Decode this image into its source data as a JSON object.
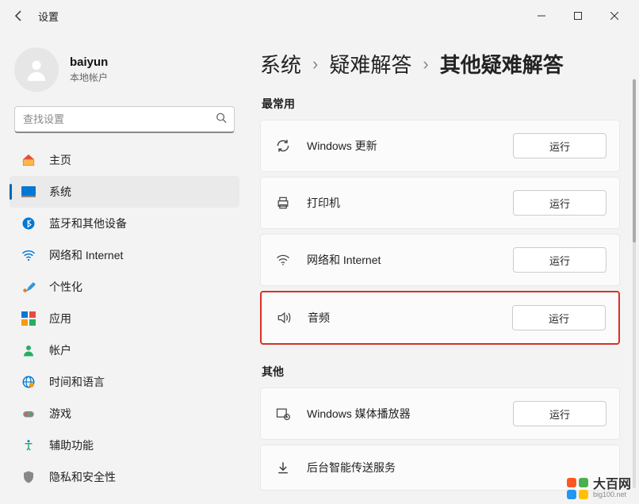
{
  "window": {
    "title": "设置"
  },
  "profile": {
    "name": "baiyun",
    "sub": "本地帐户"
  },
  "search": {
    "placeholder": "查找设置"
  },
  "nav": {
    "items": [
      {
        "label": "主页"
      },
      {
        "label": "系统"
      },
      {
        "label": "蓝牙和其他设备"
      },
      {
        "label": "网络和 Internet"
      },
      {
        "label": "个性化"
      },
      {
        "label": "应用"
      },
      {
        "label": "帐户"
      },
      {
        "label": "时间和语言"
      },
      {
        "label": "游戏"
      },
      {
        "label": "辅助功能"
      },
      {
        "label": "隐私和安全性"
      }
    ]
  },
  "breadcrumb": {
    "a": "系统",
    "b": "疑难解答",
    "c": "其他疑难解答"
  },
  "sections": {
    "frequent": "最常用",
    "other": "其他"
  },
  "troubleshooters": {
    "frequent": [
      {
        "label": "Windows 更新",
        "action": "运行"
      },
      {
        "label": "打印机",
        "action": "运行"
      },
      {
        "label": "网络和 Internet",
        "action": "运行"
      },
      {
        "label": "音频",
        "action": "运行"
      }
    ],
    "other": [
      {
        "label": "Windows 媒体播放器",
        "action": "运行"
      },
      {
        "label": "后台智能传送服务",
        "action": ""
      }
    ]
  },
  "watermark": {
    "text": "大百网",
    "url": "big100.net"
  }
}
